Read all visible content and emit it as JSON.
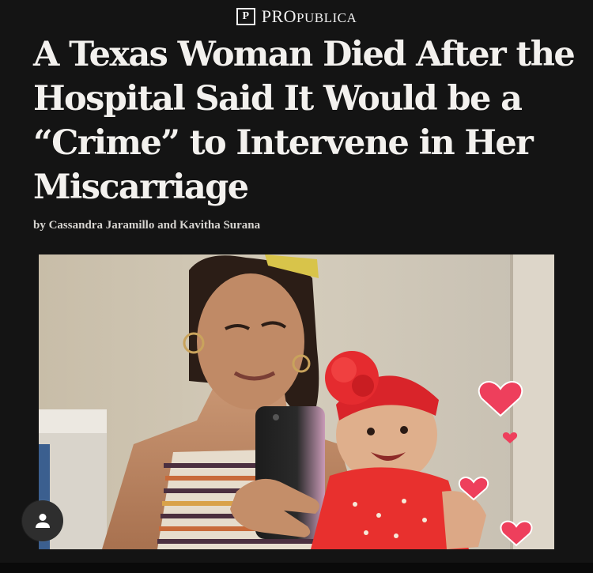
{
  "brand": {
    "icon": "propublica-logo-icon",
    "mark": "P",
    "name_prefix": "Pro",
    "name_suffix": "Publica"
  },
  "article": {
    "headline": "A Texas Woman Died After the Hospital Said It Would be a “Crime” to Intervene in Her Miscarriage",
    "byline": "by Cassandra Jaramillo and Kavitha Surana"
  },
  "photo": {
    "icon": "article-photo",
    "sticker_icon": "heart-icon"
  },
  "overlay": {
    "avatar_icon": "person-icon"
  },
  "colors": {
    "background": "#141414",
    "headline": "#f3f1ee",
    "byline": "#d6d4d0",
    "heart": "#ee3f5c"
  }
}
